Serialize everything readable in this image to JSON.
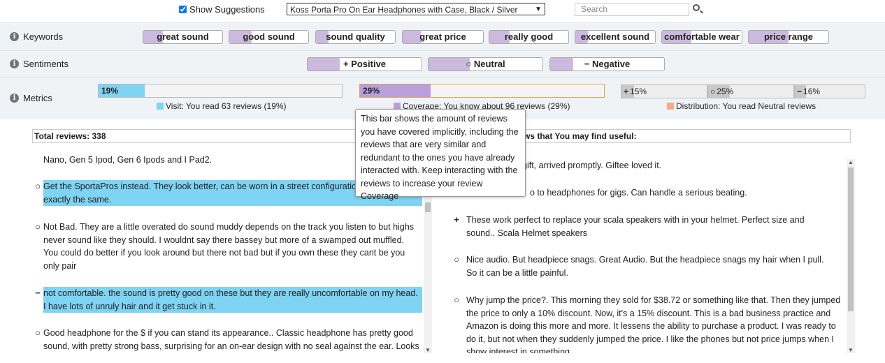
{
  "top": {
    "show_suggestions_label": "Show Suggestions",
    "product_select": "Koss Porta Pro On Ear Headphones with Case, Black / Silver",
    "search_placeholder": "Search"
  },
  "keywords": {
    "label": "Keywords",
    "items": [
      {
        "text": "great sound",
        "fill": 0.25
      },
      {
        "text": "good sound",
        "fill": 0.28
      },
      {
        "text": "sound quality",
        "fill": 0.16
      },
      {
        "text": "great price",
        "fill": 0.23
      },
      {
        "text": "really good",
        "fill": 0.26
      },
      {
        "text": "excellent sound",
        "fill": 0.16
      },
      {
        "text": "comfortable wear",
        "fill": 0.37
      },
      {
        "text": "price range",
        "fill": 0.5
      }
    ]
  },
  "sentiments": {
    "label": "Sentiments",
    "items": [
      {
        "symbol": "+",
        "text": "Positive",
        "fill": 0.28
      },
      {
        "symbol": "○",
        "text": "Neutral",
        "fill": 0.36
      },
      {
        "symbol": "−",
        "text": "Negative",
        "fill": 0.2
      }
    ]
  },
  "metrics": {
    "label": "Metrics",
    "visit": {
      "value": "19%",
      "fraction": 0.19,
      "legend": "Visit: You read 63 reviews (19%)",
      "color": "#7fd3f3"
    },
    "coverage": {
      "value": "29%",
      "fraction": 0.29,
      "legend": "Coverage: You know about 96 reviews (29%)",
      "color": "#b99fdc"
    },
    "distribution": {
      "legend": "Distribution: You read Neutral reviews",
      "color": "#f7a98a",
      "segments": [
        {
          "symbol": "+",
          "value": "15%",
          "fraction": 0.15
        },
        {
          "symbol": "○",
          "value": "25%",
          "fraction": 0.25
        },
        {
          "symbol": "−",
          "value": "16%",
          "fraction": 0.16
        }
      ]
    }
  },
  "tooltip": "This bar shows the amount of reviews you have covered implicitly, including the reviews that are very similar and redundant to the ones you have already interacted with. Keep interacting with the reviews to increase your review Coverage",
  "left_panel": {
    "title": "Total reviews: 338",
    "partial_top": "Nano, Gen 5 Ipod, Gen 6 Ipods and I Pad2.",
    "reviews": [
      {
        "icon": "○",
        "highlighted": true,
        "text": "Get the SportaPros instead. They look better, can be worn in a street configuration, and sound exactly the same."
      },
      {
        "icon": "○",
        "highlighted": false,
        "text": "Not Bad. They are a little overated do sound muddy depends on the track you listen to but highs never sound like they should. I wouldnt say there bassey but more of a swamped out muffled. You could do better if you look around but there not bad but if you own these they cant be you only pair"
      },
      {
        "icon": "−",
        "highlighted": true,
        "text": "not comfortable. the sound is pretty good on these but they are really uncomfortable on my head. I have lots of unruly hair and it get stuck in it."
      },
      {
        "icon": "○",
        "highlighted": false,
        "text": "Good headphone for the $ if you can stand its appearance.. Classic headphone has pretty good sound, with pretty strong bass, surprising for an on-ear design with no seal against the ear. Looks"
      }
    ]
  },
  "right_panel": {
    "title": "ws that You may find useful:",
    "reviews": [
      {
        "icon": "",
        "text": "gift, arrived promptly. Giftee loved it."
      },
      {
        "icon": "",
        "text": "o to headphones for gigs. Can handle a serious beating."
      },
      {
        "icon": "+",
        "text": "These work perfect to replace your scala speakers with in your helmet. Perfect size and sound.. Scala Helmet speakers"
      },
      {
        "icon": "○",
        "text": "Nice audio. But headpiece snags. Great Audio. But the headpiece snags my hair when I pull. So it can be a little painful."
      },
      {
        "icon": "○",
        "text": "Why jump the price?. This morning they sold for $38.72 or something like that. Then they jumped the price to only a 10% discount. Now, it's a 15% discount. This is a bad business practice and Amazon is doing this more and more. It lessens the ability to purchase a product. I was ready to do it, but not when they suddenly jumped the price. I like the phones but not price jumps when I show interest in something."
      }
    ]
  }
}
